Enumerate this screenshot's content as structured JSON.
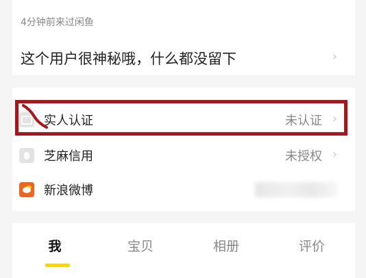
{
  "header": {
    "last_seen": "4分钟前来过闲鱼"
  },
  "profile": {
    "bio": "这个用户很神秘哦，什么都没留下"
  },
  "verification": {
    "items": [
      {
        "label": "实人认证",
        "status": "未认证",
        "icon": "id-card-icon"
      },
      {
        "label": "芝麻信用",
        "status": "未授权",
        "icon": "sesame-credit-icon"
      },
      {
        "label": "新浪微博",
        "status": "",
        "icon": "weibo-icon",
        "status_obscured": true
      }
    ]
  },
  "tabs": [
    {
      "label": "我",
      "active": true
    },
    {
      "label": "宝贝",
      "active": false
    },
    {
      "label": "相册",
      "active": false
    },
    {
      "label": "评价",
      "active": false
    }
  ],
  "colors": {
    "highlight": "#a8151b",
    "accent": "#ffd400",
    "weibo": "#f2631f"
  },
  "chevron": "›"
}
